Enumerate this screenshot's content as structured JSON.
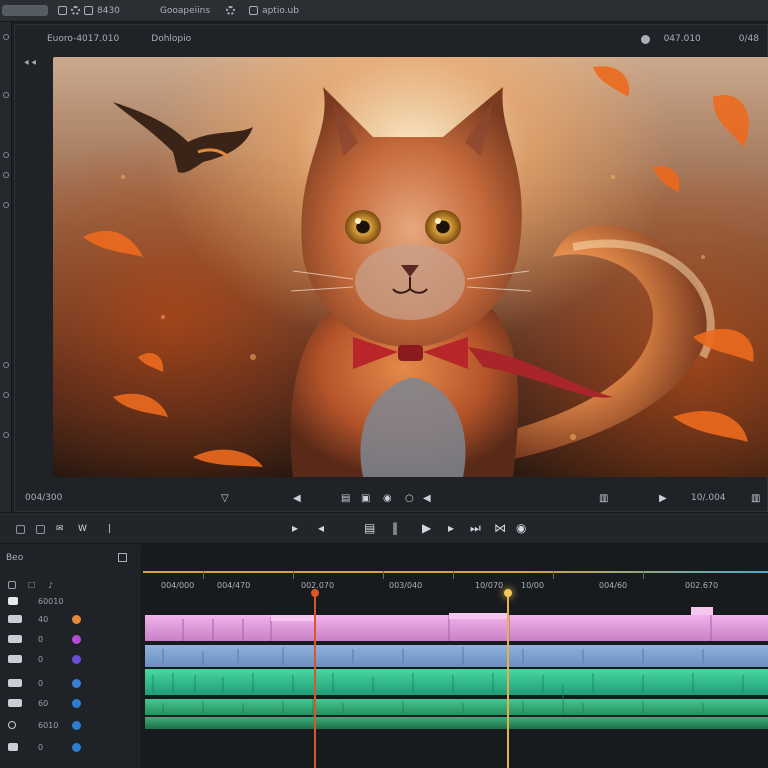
{
  "menubar": {
    "items": [
      "8430",
      "Gooapeiins",
      "aptio.ub"
    ]
  },
  "viewer": {
    "source_label": "Euoro-4017.010",
    "sequence_label": "Dohlopio",
    "timecode_left": "047.010",
    "timecode_right": "0/48",
    "duration_left": "004/300",
    "duration_right": "10/.004"
  },
  "track_panel": {
    "header": "Beo",
    "tracks": [
      {
        "name": "60010",
        "bulb": ""
      },
      {
        "name": "40",
        "bulb": "#e58a3a"
      },
      {
        "name": "0",
        "bulb": "#b34cd6"
      },
      {
        "name": "0",
        "bulb": "#6a4cd6"
      },
      {
        "name": "0",
        "bulb": "#3a7ed6"
      },
      {
        "name": "60",
        "bulb": "#2c7fd0"
      },
      {
        "name": "6010",
        "bulb": "#2c7fd0"
      },
      {
        "name": "0",
        "bulb": "#2c7fd0"
      }
    ]
  },
  "timeline": {
    "ruler": [
      "004/000",
      "004/470",
      "002.070",
      "003/040",
      "10/070",
      "10/00",
      "004/60",
      "002.670"
    ],
    "playhead_red_color": "#e0542a",
    "playhead_yellow_color": "#f0b33a"
  }
}
